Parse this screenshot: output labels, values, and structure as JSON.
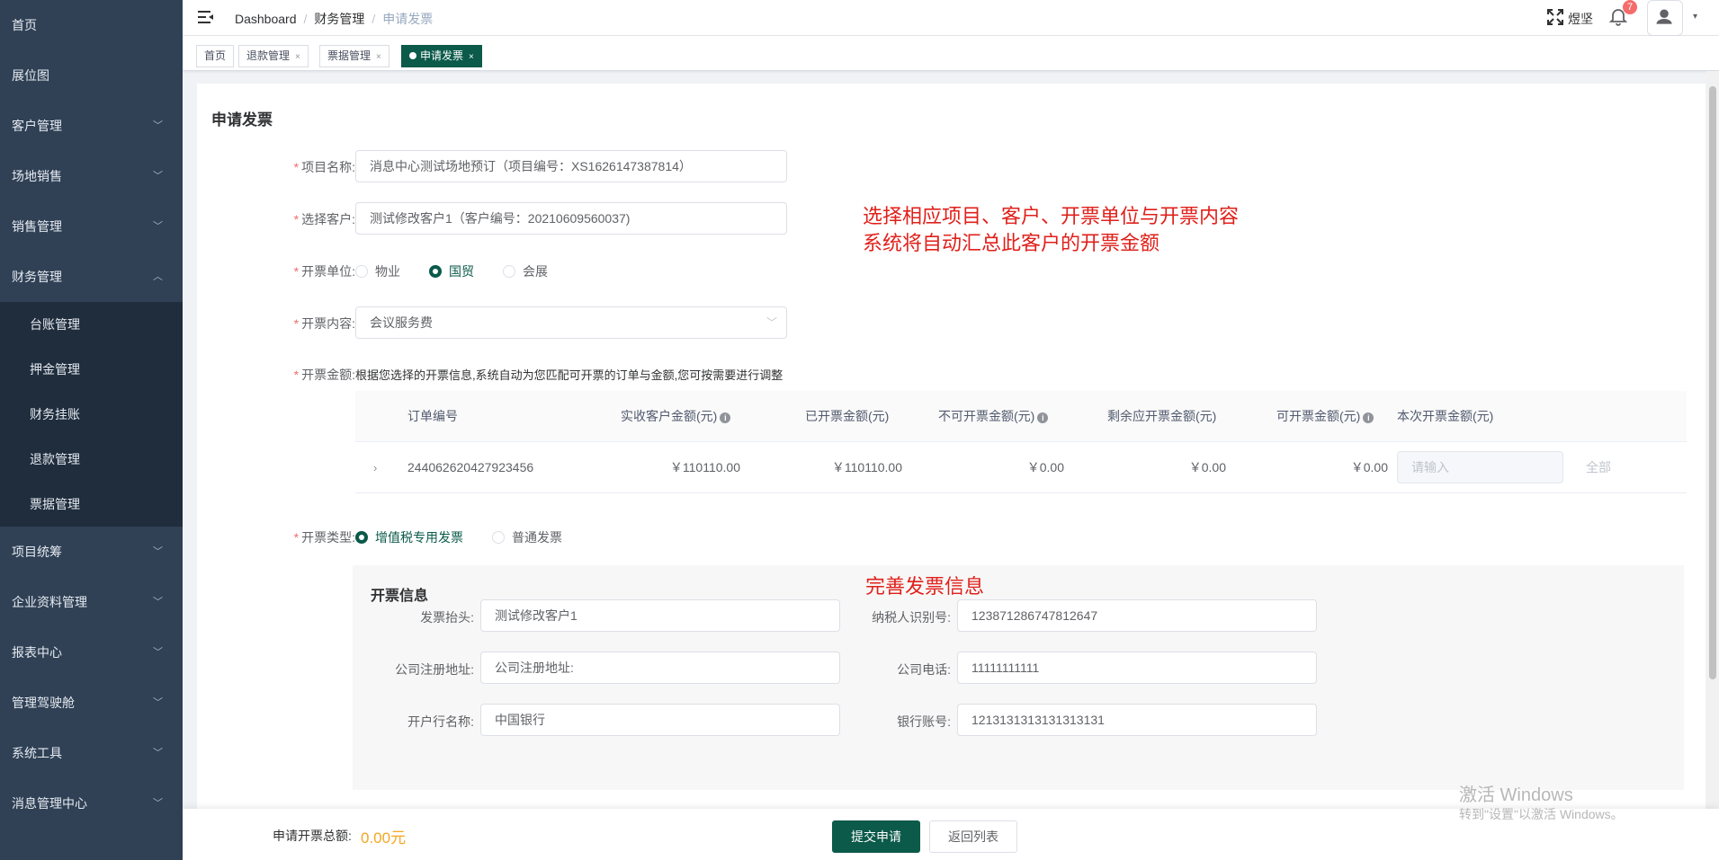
{
  "sidebar": {
    "items": [
      {
        "label": "首页",
        "arrow": ""
      },
      {
        "label": "展位图",
        "arrow": ""
      },
      {
        "label": "客户管理",
        "arrow": "﹀"
      },
      {
        "label": "场地销售",
        "arrow": "﹀"
      },
      {
        "label": "销售管理",
        "arrow": "﹀"
      },
      {
        "label": "财务管理",
        "arrow": "︿"
      }
    ],
    "sub_items": [
      "台账管理",
      "押金管理",
      "财务挂账",
      "退款管理",
      "票据管理"
    ],
    "items_after": [
      {
        "label": "项目统筹",
        "arrow": "﹀"
      },
      {
        "label": "企业资料管理",
        "arrow": "﹀"
      },
      {
        "label": "报表中心",
        "arrow": "﹀"
      },
      {
        "label": "管理驾驶舱",
        "arrow": "﹀"
      },
      {
        "label": "系统工具",
        "arrow": "﹀"
      },
      {
        "label": "消息管理中心",
        "arrow": "﹀"
      }
    ]
  },
  "header": {
    "breadcrumb": [
      "Dashboard",
      "财务管理",
      "申请发票"
    ],
    "breadcrumb_sep": "/",
    "user_name": "煜坚",
    "notification_count": "7",
    "avatar_caret": "▾"
  },
  "tags": [
    {
      "label": "首页",
      "close": ""
    },
    {
      "label": "退款管理",
      "close": "×"
    },
    {
      "label": "票据管理",
      "close": "×"
    },
    {
      "label": "申请发票",
      "close": "×"
    }
  ],
  "page": {
    "title": "申请发票",
    "fields": {
      "project_label": "项目名称:",
      "project_value": "消息中心测试场地预订（项目编号：XS1626147387814）",
      "customer_label": "选择客户:",
      "customer_value": "测试修改客户1（客户编号：20210609560037)",
      "unit_label": "开票单位:",
      "unit_options": [
        "物业",
        "国贸",
        "会展"
      ],
      "unit_selected": "国贸",
      "content_label": "开票内容:",
      "content_value": "会议服务费",
      "amount_label": "开票金额:",
      "amount_hint": "根据您选择的开票信息,系统自动为您匹配可开票的订单与金额,您可按需要进行调整",
      "type_label": "开票类型:",
      "type_options": [
        "增值税专用发票",
        "普通发票"
      ],
      "type_selected": "增值税专用发票"
    },
    "annotations": {
      "line1": "选择相应项目、客户、开票单位与开票内容",
      "line2": "系统将自动汇总此客户的开票金额",
      "line3": "完善发票信息"
    },
    "table": {
      "headers": [
        "订单编号",
        "实收客户金额(元)",
        "已开票金额(元)",
        "不可开票金额(元)",
        "剩余应开票金额(元)",
        "可开票金额(元)",
        "本次开票金额(元)"
      ],
      "rows": [
        {
          "order_no": "244062620427923456",
          "received": "￥110110.00",
          "invoiced": "￥110110.00",
          "non_invoiceable": "￥0.00",
          "remaining": "￥0.00",
          "invoiceable": "￥0.00",
          "current_placeholder": "请输入",
          "all_link": "全部"
        }
      ],
      "expand_icon": "›",
      "info_icon": "i"
    },
    "invoice_info": {
      "title": "开票信息",
      "title_label": "发票抬头:",
      "title_value": "测试修改客户1",
      "taxid_label": "纳税人识别号:",
      "taxid_value": "123871286747812647",
      "address_label": "公司注册地址:",
      "address_value": "公司注册地址:",
      "phone_label": "公司电话:",
      "phone_value": "11111111111",
      "bank_label": "开户行名称:",
      "bank_value": "中国银行",
      "account_label": "银行账号:",
      "account_value": "1213131313131313131"
    }
  },
  "footer": {
    "total_label": "申请开票总额:",
    "total_value": "0.00元",
    "submit_label": "提交申请",
    "back_label": "返回列表"
  },
  "watermark": {
    "line1": "激活 Windows",
    "line2": "转到\"设置\"以激活 Windows。"
  },
  "colors": {
    "primary": "#0b5a4a",
    "sidebar_bg": "#304156",
    "annotation": "#e0201b",
    "total": "#f5a623"
  }
}
